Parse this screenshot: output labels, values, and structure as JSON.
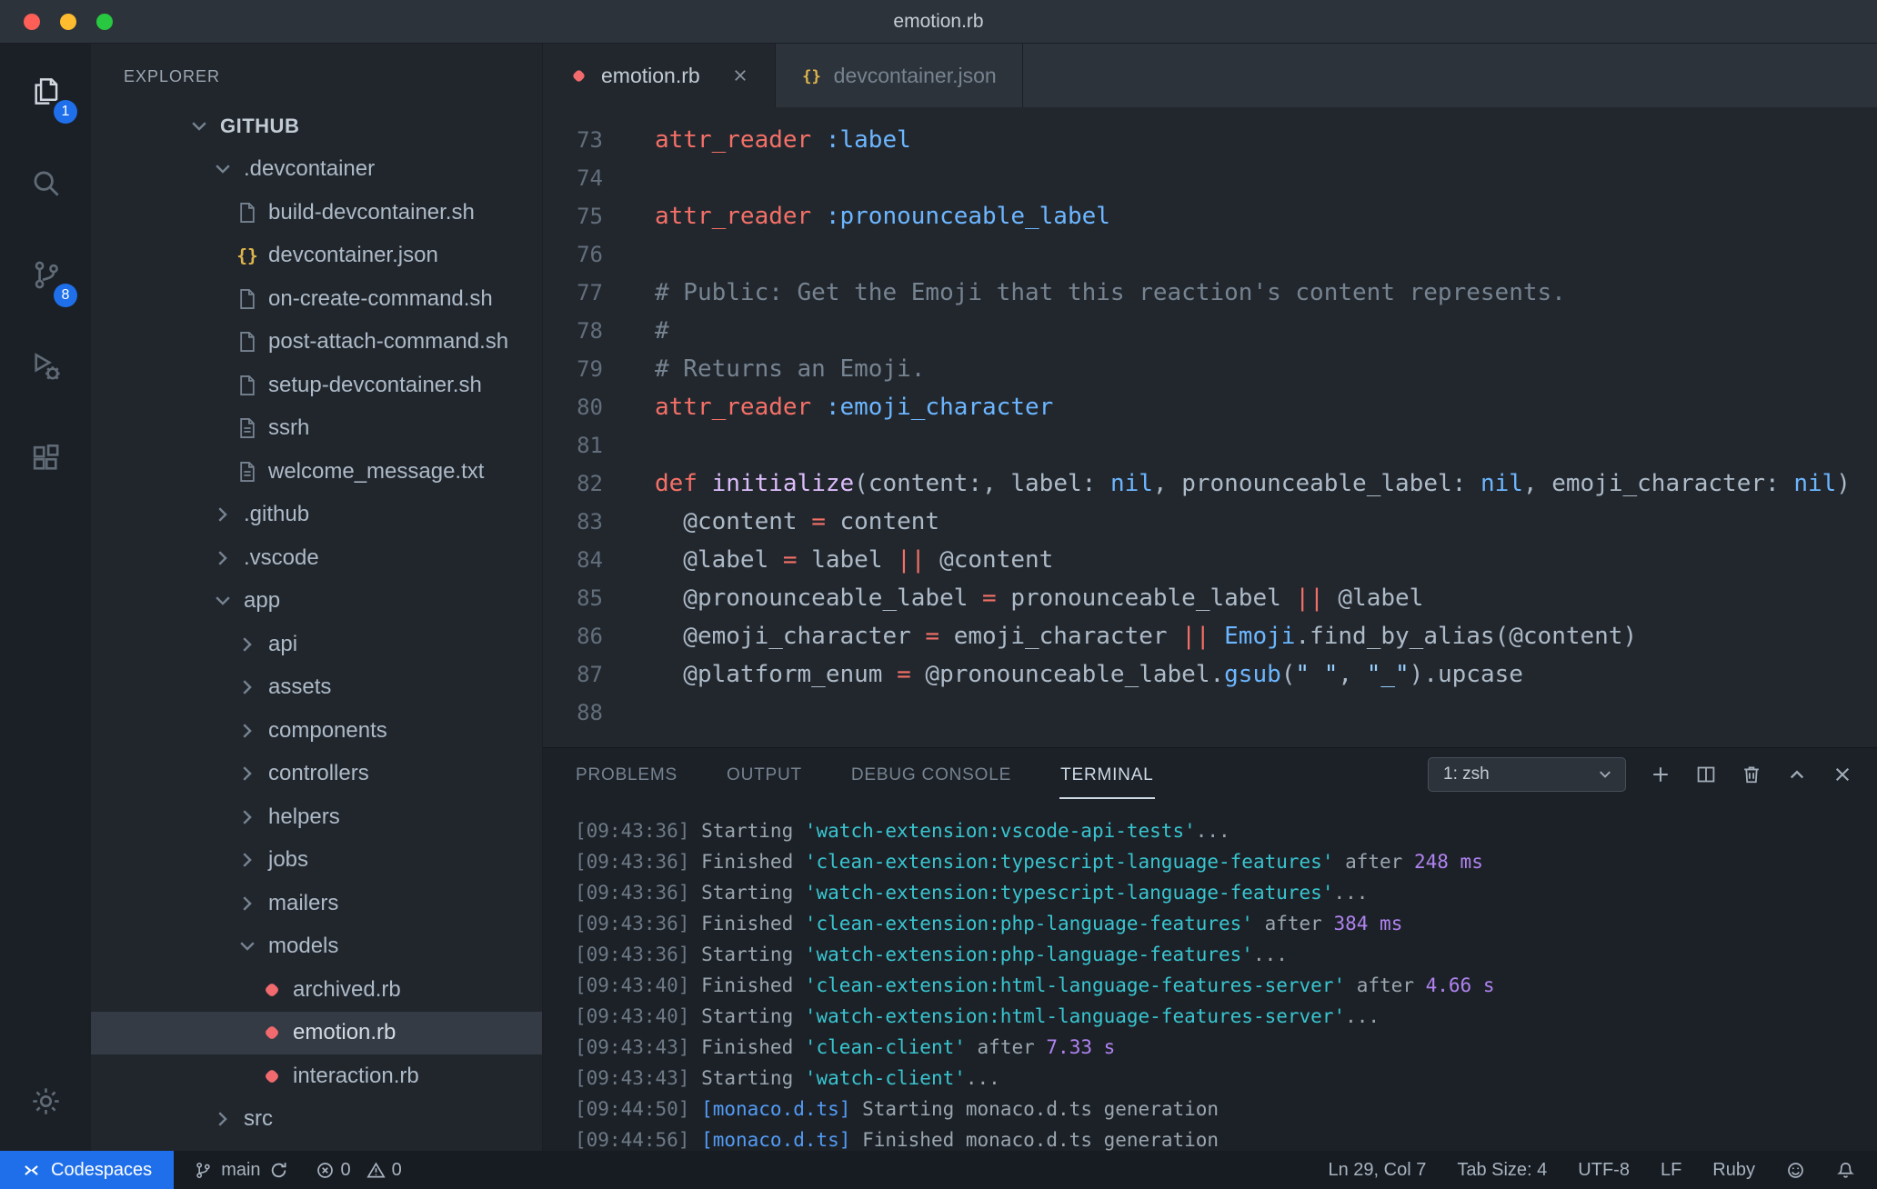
{
  "window": {
    "title": "emotion.rb"
  },
  "activity_bar": {
    "items": [
      {
        "id": "explorer",
        "icon": "files",
        "badge": "1",
        "active": true
      },
      {
        "id": "search",
        "icon": "search"
      },
      {
        "id": "source-control",
        "icon": "branch",
        "badge": "8"
      },
      {
        "id": "run-debug",
        "icon": "debug"
      },
      {
        "id": "extensions",
        "icon": "extensions"
      }
    ],
    "settings_icon": "gear"
  },
  "sidebar": {
    "header": "EXPLORER",
    "root": "GITHUB",
    "tree": [
      {
        "label": ".devcontainer",
        "kind": "folder",
        "expanded": true,
        "indent": 0
      },
      {
        "label": "build-devcontainer.sh",
        "kind": "file",
        "icon": "file",
        "indent": 1
      },
      {
        "label": "devcontainer.json",
        "kind": "file",
        "icon": "json",
        "indent": 1
      },
      {
        "label": "on-create-command.sh",
        "kind": "file",
        "icon": "file",
        "indent": 1
      },
      {
        "label": "post-attach-command.sh",
        "kind": "file",
        "icon": "file",
        "indent": 1
      },
      {
        "label": "setup-devcontainer.sh",
        "kind": "file",
        "icon": "file",
        "indent": 1
      },
      {
        "label": "ssrh",
        "kind": "file",
        "icon": "text",
        "indent": 1
      },
      {
        "label": "welcome_message.txt",
        "kind": "file",
        "icon": "text",
        "indent": 1
      },
      {
        "label": ".github",
        "kind": "folder",
        "expanded": false,
        "indent": 0
      },
      {
        "label": ".vscode",
        "kind": "folder",
        "expanded": false,
        "indent": 0
      },
      {
        "label": "app",
        "kind": "folder",
        "expanded": true,
        "indent": 0
      },
      {
        "label": "api",
        "kind": "folder",
        "expanded": false,
        "indent": 1
      },
      {
        "label": "assets",
        "kind": "folder",
        "expanded": false,
        "indent": 1
      },
      {
        "label": "components",
        "kind": "folder",
        "expanded": false,
        "indent": 1
      },
      {
        "label": "controllers",
        "kind": "folder",
        "expanded": false,
        "indent": 1
      },
      {
        "label": "helpers",
        "kind": "folder",
        "expanded": false,
        "indent": 1
      },
      {
        "label": "jobs",
        "kind": "folder",
        "expanded": false,
        "indent": 1
      },
      {
        "label": "mailers",
        "kind": "folder",
        "expanded": false,
        "indent": 1
      },
      {
        "label": "models",
        "kind": "folder",
        "expanded": true,
        "indent": 1
      },
      {
        "label": "archived.rb",
        "kind": "file",
        "icon": "ruby",
        "indent": 2
      },
      {
        "label": "emotion.rb",
        "kind": "file",
        "icon": "ruby",
        "indent": 2,
        "selected": true
      },
      {
        "label": "interaction.rb",
        "kind": "file",
        "icon": "ruby",
        "indent": 2
      },
      {
        "label": "src",
        "kind": "folder",
        "expanded": false,
        "indent": 0
      }
    ]
  },
  "tabs": [
    {
      "label": "emotion.rb",
      "icon": "ruby",
      "active": true,
      "closable": true
    },
    {
      "label": "devcontainer.json",
      "icon": "json",
      "active": false,
      "closable": false
    }
  ],
  "editor": {
    "lines": [
      {
        "n": 73,
        "tokens": [
          [
            "attr_reader",
            "k"
          ],
          [
            " ",
            "d"
          ],
          [
            ":label",
            "s"
          ]
        ]
      },
      {
        "n": 74,
        "tokens": []
      },
      {
        "n": 75,
        "tokens": [
          [
            "attr_reader",
            "k"
          ],
          [
            " ",
            "d"
          ],
          [
            ":pronounceable_label",
            "s"
          ]
        ]
      },
      {
        "n": 76,
        "tokens": []
      },
      {
        "n": 77,
        "tokens": [
          [
            "# Public: Get the Emoji that this reaction's content represents.",
            "c"
          ]
        ]
      },
      {
        "n": 78,
        "tokens": [
          [
            "#",
            "c"
          ]
        ]
      },
      {
        "n": 79,
        "tokens": [
          [
            "# Returns an Emoji.",
            "c"
          ]
        ]
      },
      {
        "n": 80,
        "tokens": [
          [
            "attr_reader",
            "k"
          ],
          [
            " ",
            "d"
          ],
          [
            ":emoji_character",
            "s"
          ]
        ]
      },
      {
        "n": 81,
        "tokens": []
      },
      {
        "n": 82,
        "tokens": [
          [
            "def",
            "k"
          ],
          [
            " ",
            "d"
          ],
          [
            "initialize",
            "fn"
          ],
          [
            "(content:, label: ",
            "d"
          ],
          [
            "nil",
            "s"
          ],
          [
            ", pronounceable_label: ",
            "d"
          ],
          [
            "nil",
            "s"
          ],
          [
            ", emoji_character: ",
            "d"
          ],
          [
            "nil",
            "s"
          ],
          [
            ")",
            "d"
          ]
        ]
      },
      {
        "n": 83,
        "tokens": [
          [
            "  @content ",
            "d"
          ],
          [
            "=",
            "k"
          ],
          [
            " content",
            "d"
          ]
        ]
      },
      {
        "n": 84,
        "tokens": [
          [
            "  @label ",
            "d"
          ],
          [
            "=",
            "k"
          ],
          [
            " label ",
            "d"
          ],
          [
            "||",
            "k"
          ],
          [
            " @content",
            "d"
          ]
        ]
      },
      {
        "n": 85,
        "tokens": [
          [
            "  @pronounceable_label ",
            "d"
          ],
          [
            "=",
            "k"
          ],
          [
            " pronounceable_label ",
            "d"
          ],
          [
            "||",
            "k"
          ],
          [
            " @label",
            "d"
          ]
        ]
      },
      {
        "n": 86,
        "tokens": [
          [
            "  @emoji_character ",
            "d"
          ],
          [
            "=",
            "k"
          ],
          [
            " emoji_character ",
            "d"
          ],
          [
            "||",
            "k"
          ],
          [
            " ",
            "d"
          ],
          [
            "Emoji",
            "s"
          ],
          [
            ".find_by_alias(@content)",
            "d"
          ]
        ]
      },
      {
        "n": 87,
        "tokens": [
          [
            "  @platform_enum ",
            "d"
          ],
          [
            "=",
            "k"
          ],
          [
            " @pronounceable_label.",
            "d"
          ],
          [
            "gsub",
            "s"
          ],
          [
            "(",
            "d"
          ],
          [
            "\" \"",
            "str"
          ],
          [
            ", ",
            "d"
          ],
          [
            "\"_\"",
            "str"
          ],
          [
            ").upcase",
            "d"
          ]
        ]
      },
      {
        "n": 88,
        "tokens": []
      }
    ]
  },
  "panel": {
    "tabs": [
      {
        "label": "PROBLEMS"
      },
      {
        "label": "OUTPUT"
      },
      {
        "label": "DEBUG CONSOLE"
      },
      {
        "label": "TERMINAL",
        "active": true
      }
    ],
    "shell_select": "1: zsh",
    "terminal_lines": [
      {
        "tokens": [
          [
            "[09:43:36] ",
            "dim"
          ],
          [
            "Starting ",
            "d"
          ],
          [
            "'watch-extension:vscode-api-tests'",
            "task"
          ],
          [
            "...",
            "d"
          ]
        ]
      },
      {
        "tokens": [
          [
            "[09:43:36] ",
            "dim"
          ],
          [
            "Finished ",
            "d"
          ],
          [
            "'clean-extension:typescript-language-features'",
            "task"
          ],
          [
            " after ",
            "d"
          ],
          [
            "248 ms",
            "dur"
          ]
        ]
      },
      {
        "tokens": [
          [
            "[09:43:36] ",
            "dim"
          ],
          [
            "Starting ",
            "d"
          ],
          [
            "'watch-extension:typescript-language-features'",
            "task"
          ],
          [
            "...",
            "d"
          ]
        ]
      },
      {
        "tokens": [
          [
            "[09:43:36] ",
            "dim"
          ],
          [
            "Finished ",
            "d"
          ],
          [
            "'clean-extension:php-language-features'",
            "task"
          ],
          [
            " after ",
            "d"
          ],
          [
            "384 ms",
            "dur"
          ]
        ]
      },
      {
        "tokens": [
          [
            "[09:43:36] ",
            "dim"
          ],
          [
            "Starting ",
            "d"
          ],
          [
            "'watch-extension:php-language-features'",
            "task"
          ],
          [
            "...",
            "d"
          ]
        ]
      },
      {
        "tokens": [
          [
            "[09:43:40] ",
            "dim"
          ],
          [
            "Finished ",
            "d"
          ],
          [
            "'clean-extension:html-language-features-server'",
            "task"
          ],
          [
            " after ",
            "d"
          ],
          [
            "4.66 s",
            "dur"
          ]
        ]
      },
      {
        "tokens": [
          [
            "[09:43:40] ",
            "dim"
          ],
          [
            "Starting ",
            "d"
          ],
          [
            "'watch-extension:html-language-features-server'",
            "task"
          ],
          [
            "...",
            "d"
          ]
        ]
      },
      {
        "tokens": [
          [
            "[09:43:43] ",
            "dim"
          ],
          [
            "Finished ",
            "d"
          ],
          [
            "'clean-client'",
            "task"
          ],
          [
            " after ",
            "d"
          ],
          [
            "7.33 s",
            "dur"
          ]
        ]
      },
      {
        "tokens": [
          [
            "[09:43:43] ",
            "dim"
          ],
          [
            "Starting ",
            "d"
          ],
          [
            "'watch-client'",
            "task"
          ],
          [
            "...",
            "d"
          ]
        ]
      },
      {
        "tokens": [
          [
            "[09:44:50] ",
            "dim"
          ],
          [
            "[monaco.d.ts]",
            "file"
          ],
          [
            " Starting monaco.d.ts generation",
            "d"
          ]
        ]
      },
      {
        "tokens": [
          [
            "[09:44:56] ",
            "dim"
          ],
          [
            "[monaco.d.ts]",
            "file"
          ],
          [
            " Finished monaco.d.ts generation",
            "d"
          ]
        ]
      }
    ]
  },
  "status_bar": {
    "codespaces": "Codespaces",
    "branch": "main",
    "errors": "0",
    "warnings": "0",
    "cursor": "Ln 29, Col 7",
    "tab_size": "Tab Size: 4",
    "encoding": "UTF-8",
    "eol": "LF",
    "language": "Ruby"
  },
  "colors": {
    "accent_blue": "#1f6feb",
    "keyword": "#f47067",
    "constant": "#6cb6ff",
    "string": "#96d0ff",
    "comment": "#768390",
    "function": "#dcbdfb",
    "terminal_task": "#39c5cf",
    "terminal_duration": "#b083f0",
    "ruby_icon": "#f06a6e",
    "json_icon": "#dfb64b"
  }
}
